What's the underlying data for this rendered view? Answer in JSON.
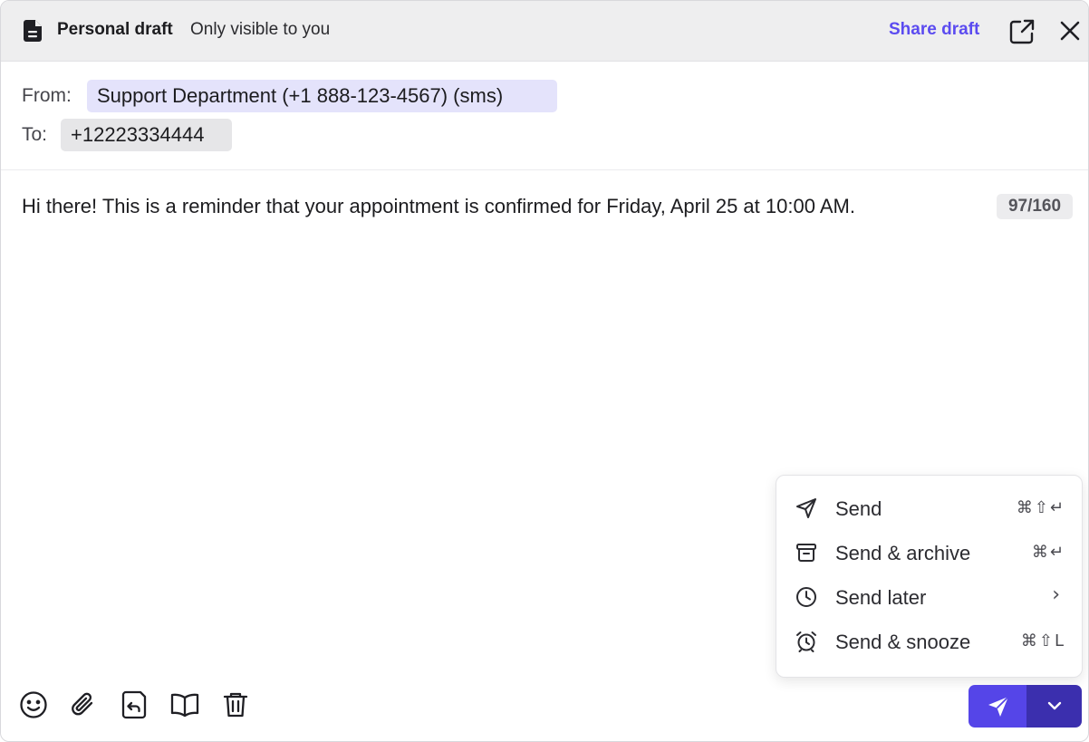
{
  "header": {
    "title": "Personal draft",
    "subtitle": "Only visible to you",
    "share_label": "Share draft",
    "icons": {
      "doc": "document-icon",
      "popout": "popout-icon",
      "close": "close-icon"
    }
  },
  "from": {
    "label": "From:",
    "value": "Support Department (+1 888-123-4567) (sms)"
  },
  "to": {
    "label": "To:",
    "value": "+12223334444"
  },
  "message": {
    "body": "Hi there! This is a reminder that your appointment is confirmed for Friday, April 25 at 10:00 AM.",
    "char_count": "97/160"
  },
  "send_menu": {
    "items": [
      {
        "label": "Send",
        "shortcut": "⌘⇧↵",
        "icon": "send-icon"
      },
      {
        "label": "Send & archive",
        "shortcut": "⌘↵",
        "icon": "archive-icon"
      },
      {
        "label": "Send later",
        "shortcut": "›",
        "icon": "clock-icon"
      },
      {
        "label": "Send & snooze",
        "shortcut": "⌘⇧L",
        "icon": "alarm-icon"
      }
    ]
  },
  "toolbar": {
    "icons": [
      "emoji-icon",
      "attachment-icon",
      "reply-template-icon",
      "knowledge-book-icon",
      "trash-icon"
    ]
  },
  "colors": {
    "accent": "#5545e8",
    "accent_dark": "#3b2fae",
    "share_link": "#5b4bf0",
    "from_chip": "#e4e3fb",
    "to_chip": "#e6e6e8",
    "header_bg": "#eeeeef"
  }
}
